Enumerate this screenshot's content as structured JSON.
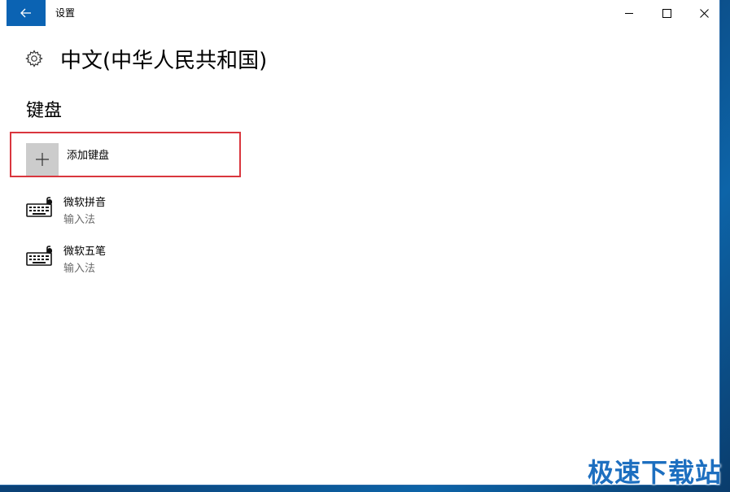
{
  "window": {
    "title": "设置",
    "controls": [
      "minimize-icon",
      "maximize-icon",
      "close-icon"
    ]
  },
  "page": {
    "title": "中文(中华人民共和国)",
    "icon": "gear-icon"
  },
  "keyboard_section": {
    "title": "键盘",
    "add_label": "添加键盘",
    "items": [
      {
        "name": "微软拼音",
        "subtitle": "输入法",
        "icon": "keyboard-icon"
      },
      {
        "name": "微软五笔",
        "subtitle": "输入法",
        "icon": "keyboard-icon"
      }
    ]
  },
  "watermark": {
    "text": "极速下载站"
  },
  "colors": {
    "accent": "#0b63b3",
    "highlight_border": "#d9363e",
    "add_tile": "#cccccc",
    "subtitle": "#6a6a6a"
  }
}
